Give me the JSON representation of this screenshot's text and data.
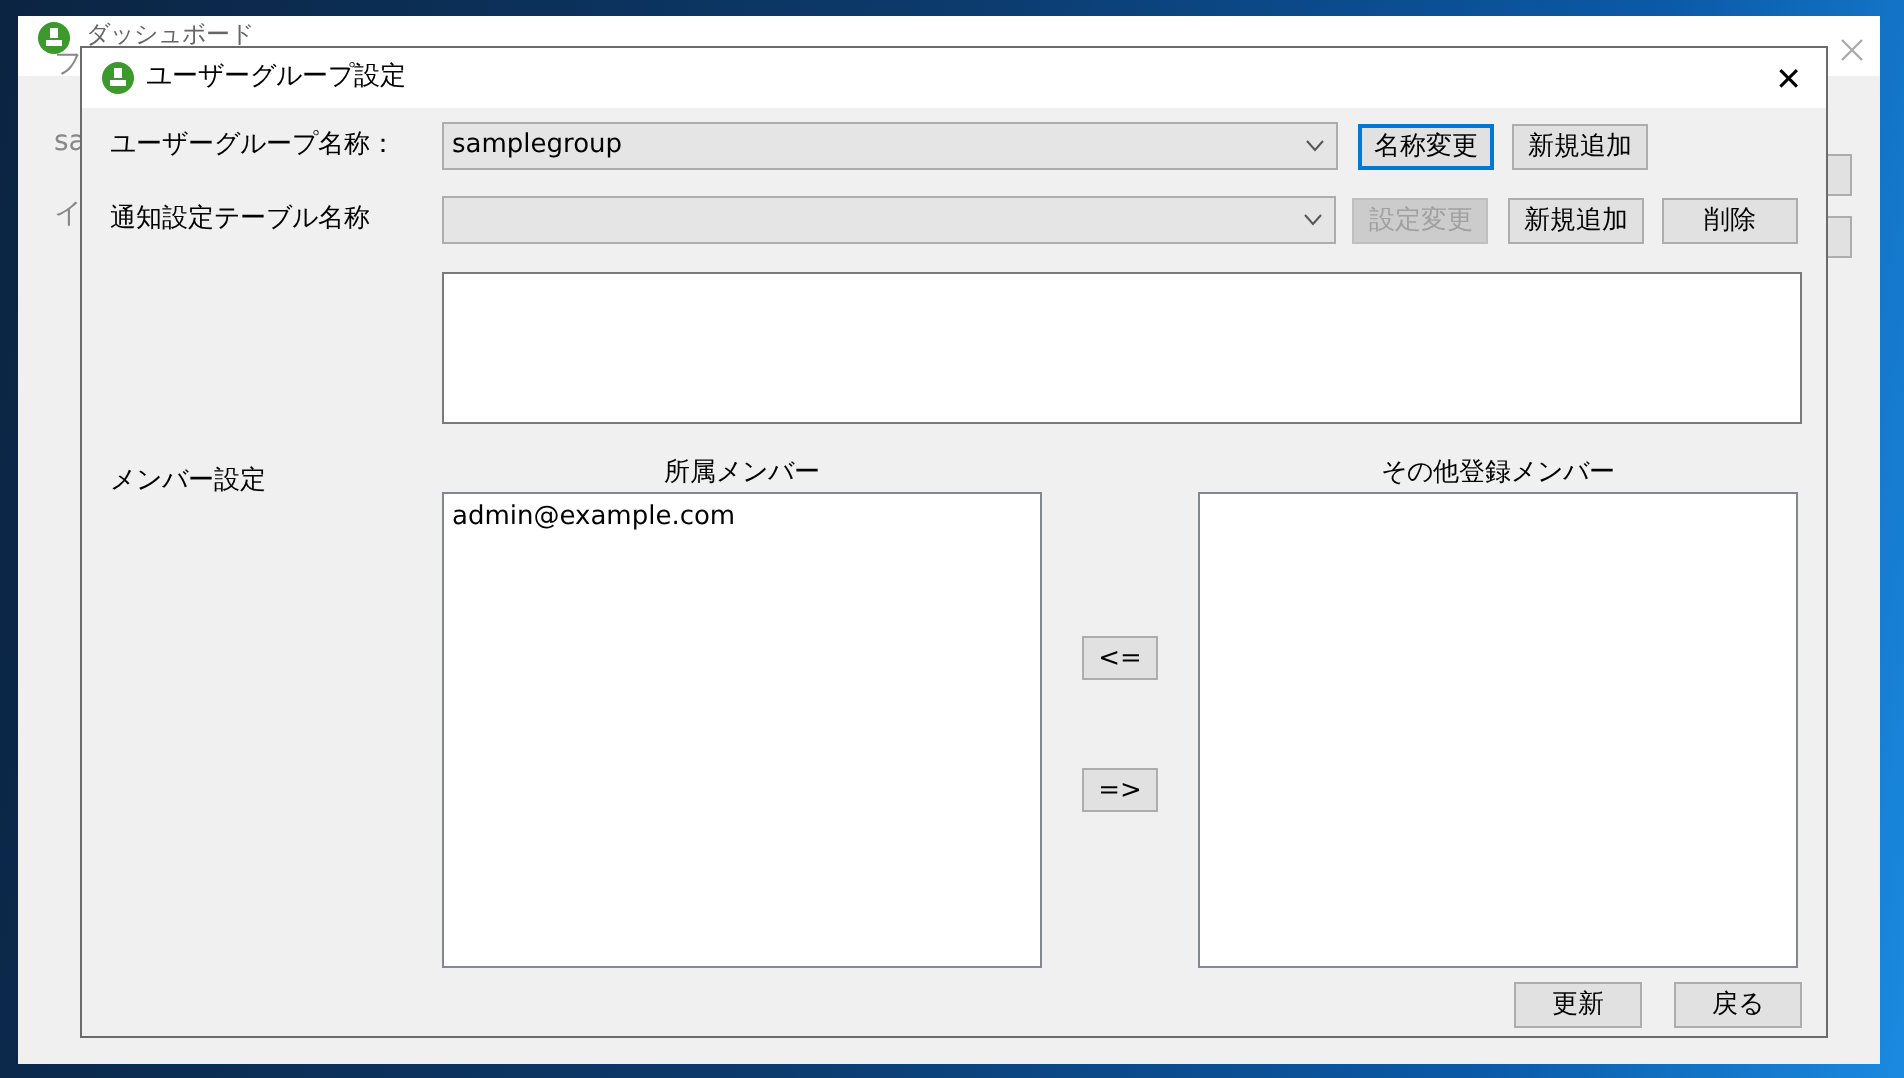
{
  "background_window": {
    "title": "ダッシュボード",
    "peek_texts": [
      "フ",
      "sa",
      "イ"
    ]
  },
  "dialog": {
    "title": "ユーザーグループ設定",
    "close": "✕"
  },
  "group_name": {
    "label": "ユーザーグループ名称：",
    "value": "samplegroup",
    "buttons": [
      {
        "label": "名称変更",
        "focused": true,
        "disabled": false
      },
      {
        "label": "新規追加",
        "focused": false,
        "disabled": false
      }
    ]
  },
  "notification_table": {
    "label": "通知設定テーブル名称",
    "buttons": [
      {
        "label": "設定変更",
        "focused": false,
        "disabled": true
      },
      {
        "label": "新規追加",
        "focused": false,
        "disabled": false
      },
      {
        "label": "削除",
        "focused": false,
        "disabled": false
      }
    ]
  },
  "members": {
    "label": "メンバー設定",
    "assigned": {
      "heading": "所属メンバー",
      "items": [
        "admin@example.com"
      ]
    },
    "others": {
      "heading": "その他登録メンバー"
    },
    "move_buttons": [
      "<=",
      "=>"
    ]
  },
  "footer_buttons": [
    "更新",
    "戻る"
  ]
}
